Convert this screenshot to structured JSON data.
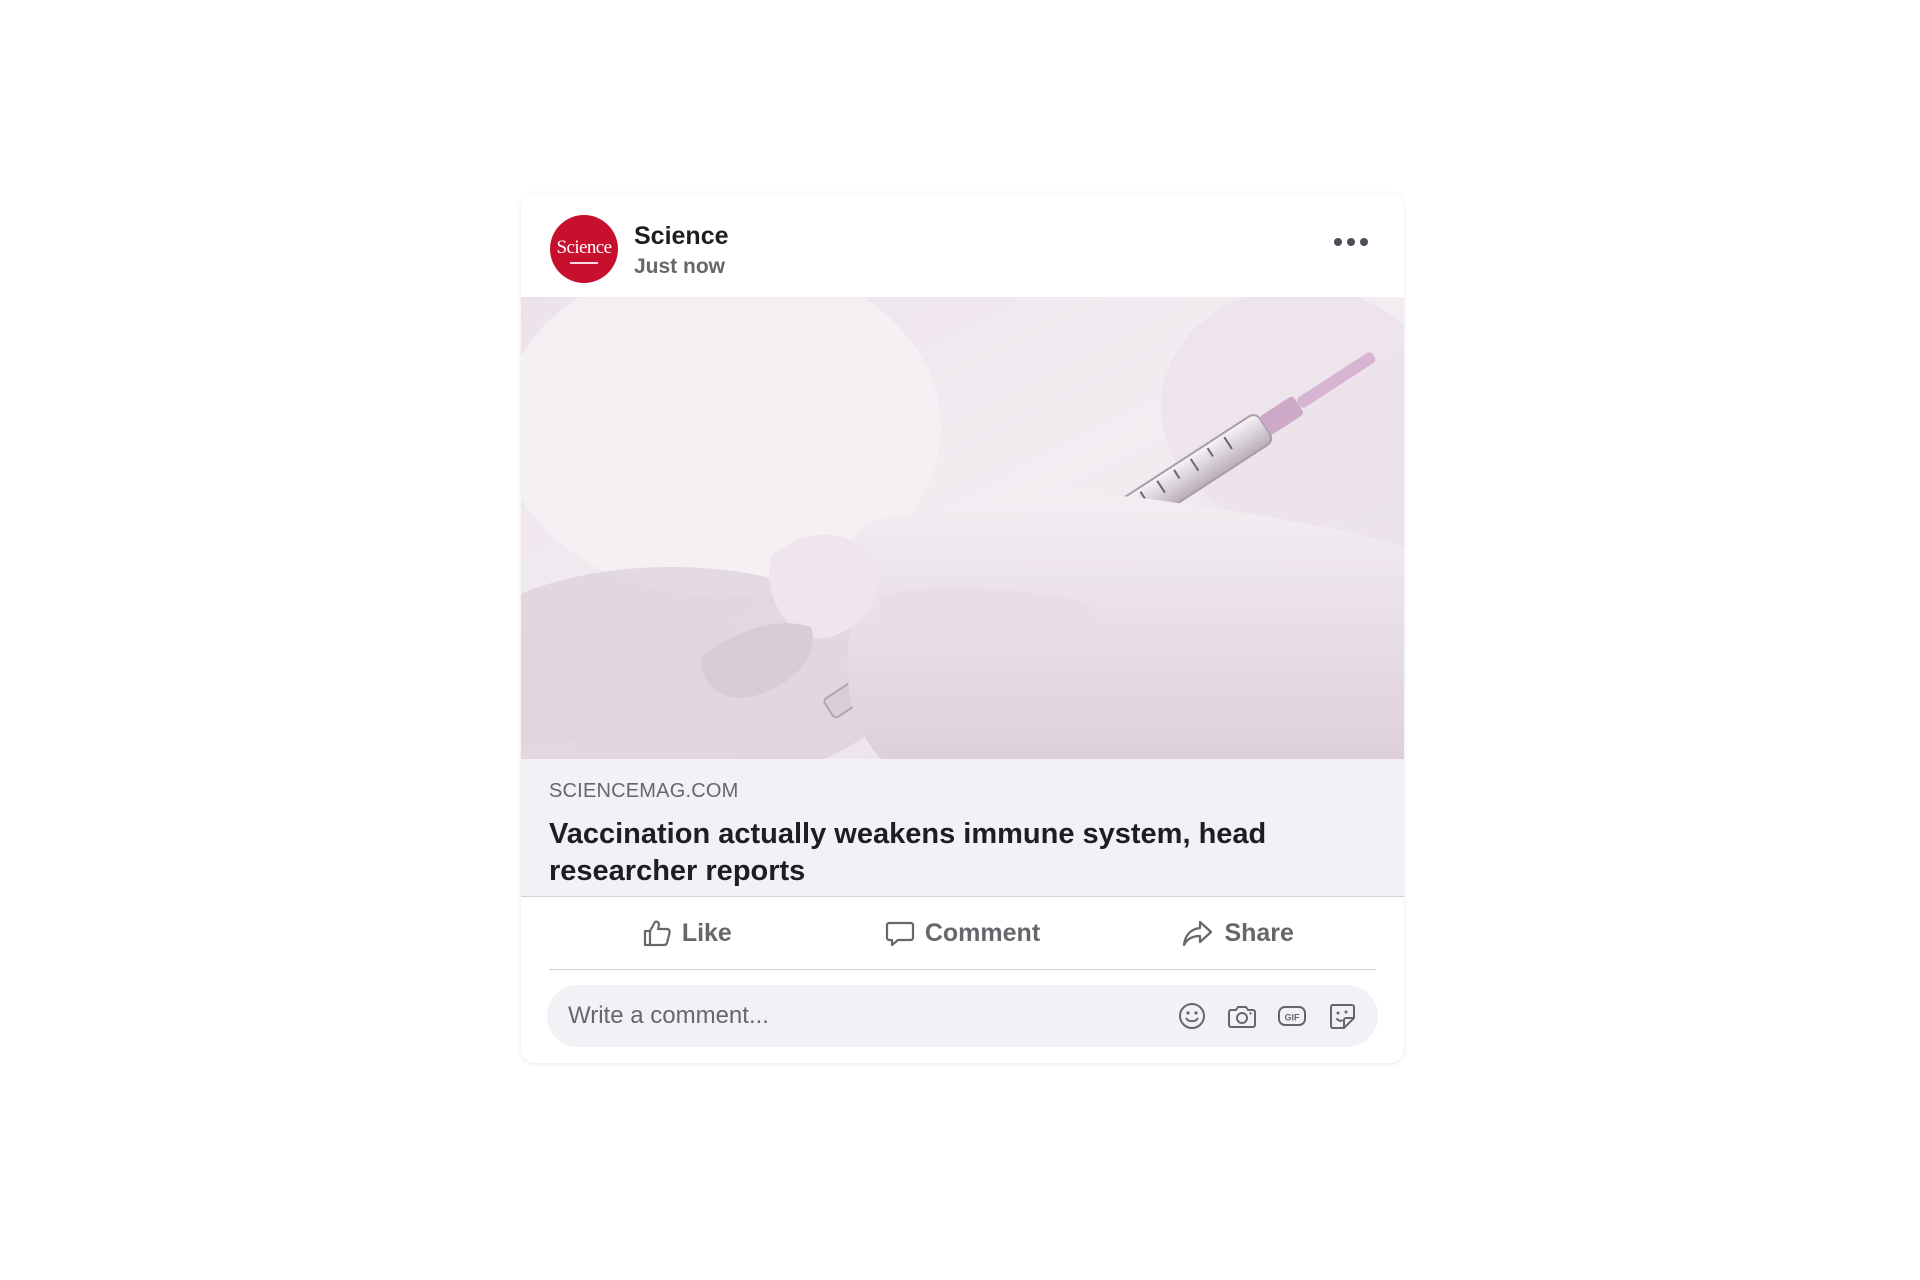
{
  "post": {
    "author": "Science",
    "avatar_text": "Science",
    "timestamp": "Just now",
    "more_icon": "more-horizontal-icon"
  },
  "link_preview": {
    "domain": "SCIENCEMAG.COM",
    "headline": "Vaccination actually weakens immune system, head researcher reports",
    "image_subject": "gloved hands holding a syringe"
  },
  "actions": {
    "like_label": "Like",
    "comment_label": "Comment",
    "share_label": "Share"
  },
  "comment_box": {
    "placeholder": "Write a comment...",
    "icons": [
      "emoji-icon",
      "camera-icon",
      "gif-icon",
      "sticker-icon"
    ]
  },
  "colors": {
    "brand_red": "#c8102e",
    "secondary_text": "#65676b",
    "primary_text": "#1c1e21",
    "preview_background": "#f0f2f5"
  }
}
